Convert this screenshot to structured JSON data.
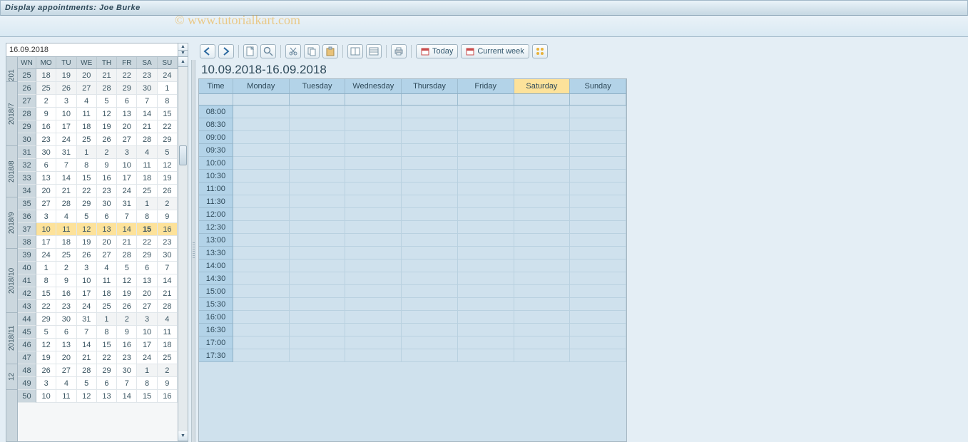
{
  "title": "Display appointments: Joe Burke",
  "watermark": "© www.tutorialkart.com",
  "date_value": "16.09.2018",
  "mini_cal": {
    "dow": [
      "WN",
      "MO",
      "TU",
      "WE",
      "TH",
      "FR",
      "SA",
      "SU"
    ],
    "months": [
      {
        "label": "201",
        "span": 1
      },
      {
        "label": "2018/7",
        "span": 5
      },
      {
        "label": "2018/8",
        "span": 4
      },
      {
        "label": "2018/9",
        "span": 4
      },
      {
        "label": "2018/10",
        "span": 5
      },
      {
        "label": "2018/11",
        "span": 4
      },
      {
        "label": "12",
        "span": 2
      }
    ],
    "weeks": [
      {
        "wn": "25",
        "d": [
          "18",
          "19",
          "20",
          "21",
          "22",
          "23",
          "24"
        ],
        "in": [
          0,
          0,
          0,
          0,
          0,
          0,
          0
        ]
      },
      {
        "wn": "26",
        "d": [
          "25",
          "26",
          "27",
          "28",
          "29",
          "30",
          "1"
        ],
        "in": [
          0,
          0,
          0,
          0,
          0,
          0,
          1
        ]
      },
      {
        "wn": "27",
        "d": [
          "2",
          "3",
          "4",
          "5",
          "6",
          "7",
          "8"
        ],
        "in": [
          1,
          1,
          1,
          1,
          1,
          1,
          1
        ]
      },
      {
        "wn": "28",
        "d": [
          "9",
          "10",
          "11",
          "12",
          "13",
          "14",
          "15"
        ],
        "in": [
          1,
          1,
          1,
          1,
          1,
          1,
          1
        ]
      },
      {
        "wn": "29",
        "d": [
          "16",
          "17",
          "18",
          "19",
          "20",
          "21",
          "22"
        ],
        "in": [
          1,
          1,
          1,
          1,
          1,
          1,
          1
        ]
      },
      {
        "wn": "30",
        "d": [
          "23",
          "24",
          "25",
          "26",
          "27",
          "28",
          "29"
        ],
        "in": [
          1,
          1,
          1,
          1,
          1,
          1,
          1
        ]
      },
      {
        "wn": "31",
        "d": [
          "30",
          "31",
          "1",
          "2",
          "3",
          "4",
          "5"
        ],
        "in": [
          1,
          1,
          0,
          0,
          0,
          0,
          0
        ]
      },
      {
        "wn": "32",
        "d": [
          "6",
          "7",
          "8",
          "9",
          "10",
          "11",
          "12"
        ],
        "in": [
          1,
          1,
          1,
          1,
          1,
          1,
          1
        ]
      },
      {
        "wn": "33",
        "d": [
          "13",
          "14",
          "15",
          "16",
          "17",
          "18",
          "19"
        ],
        "in": [
          1,
          1,
          1,
          1,
          1,
          1,
          1
        ]
      },
      {
        "wn": "34",
        "d": [
          "20",
          "21",
          "22",
          "23",
          "24",
          "25",
          "26"
        ],
        "in": [
          1,
          1,
          1,
          1,
          1,
          1,
          1
        ]
      },
      {
        "wn": "35",
        "d": [
          "27",
          "28",
          "29",
          "30",
          "31",
          "1",
          "2"
        ],
        "in": [
          1,
          1,
          1,
          1,
          1,
          0,
          0
        ]
      },
      {
        "wn": "36",
        "d": [
          "3",
          "4",
          "5",
          "6",
          "7",
          "8",
          "9"
        ],
        "in": [
          1,
          1,
          1,
          1,
          1,
          1,
          1
        ]
      },
      {
        "wn": "37",
        "d": [
          "10",
          "11",
          "12",
          "13",
          "14",
          "15",
          "16"
        ],
        "in": [
          1,
          1,
          1,
          1,
          1,
          1,
          1
        ],
        "sel": true,
        "today_idx": 5
      },
      {
        "wn": "38",
        "d": [
          "17",
          "18",
          "19",
          "20",
          "21",
          "22",
          "23"
        ],
        "in": [
          1,
          1,
          1,
          1,
          1,
          1,
          1
        ]
      },
      {
        "wn": "39",
        "d": [
          "24",
          "25",
          "26",
          "27",
          "28",
          "29",
          "30"
        ],
        "in": [
          1,
          1,
          1,
          1,
          1,
          1,
          1
        ]
      },
      {
        "wn": "40",
        "d": [
          "1",
          "2",
          "3",
          "4",
          "5",
          "6",
          "7"
        ],
        "in": [
          1,
          1,
          1,
          1,
          1,
          1,
          1
        ]
      },
      {
        "wn": "41",
        "d": [
          "8",
          "9",
          "10",
          "11",
          "12",
          "13",
          "14"
        ],
        "in": [
          1,
          1,
          1,
          1,
          1,
          1,
          1
        ]
      },
      {
        "wn": "42",
        "d": [
          "15",
          "16",
          "17",
          "18",
          "19",
          "20",
          "21"
        ],
        "in": [
          1,
          1,
          1,
          1,
          1,
          1,
          1
        ]
      },
      {
        "wn": "43",
        "d": [
          "22",
          "23",
          "24",
          "25",
          "26",
          "27",
          "28"
        ],
        "in": [
          1,
          1,
          1,
          1,
          1,
          1,
          1
        ]
      },
      {
        "wn": "44",
        "d": [
          "29",
          "30",
          "31",
          "1",
          "2",
          "3",
          "4"
        ],
        "in": [
          1,
          1,
          1,
          0,
          0,
          0,
          0
        ]
      },
      {
        "wn": "45",
        "d": [
          "5",
          "6",
          "7",
          "8",
          "9",
          "10",
          "11"
        ],
        "in": [
          1,
          1,
          1,
          1,
          1,
          1,
          1
        ]
      },
      {
        "wn": "46",
        "d": [
          "12",
          "13",
          "14",
          "15",
          "16",
          "17",
          "18"
        ],
        "in": [
          1,
          1,
          1,
          1,
          1,
          1,
          1
        ]
      },
      {
        "wn": "47",
        "d": [
          "19",
          "20",
          "21",
          "22",
          "23",
          "24",
          "25"
        ],
        "in": [
          1,
          1,
          1,
          1,
          1,
          1,
          1
        ]
      },
      {
        "wn": "48",
        "d": [
          "26",
          "27",
          "28",
          "29",
          "30",
          "1",
          "2"
        ],
        "in": [
          1,
          1,
          1,
          1,
          1,
          0,
          0
        ]
      },
      {
        "wn": "49",
        "d": [
          "3",
          "4",
          "5",
          "6",
          "7",
          "8",
          "9"
        ],
        "in": [
          1,
          1,
          1,
          1,
          1,
          1,
          1
        ]
      },
      {
        "wn": "50",
        "d": [
          "10",
          "11",
          "12",
          "13",
          "14",
          "15",
          "16"
        ],
        "in": [
          1,
          1,
          1,
          1,
          1,
          1,
          1
        ]
      }
    ]
  },
  "toolbar": {
    "today": "Today",
    "current_week": "Current week"
  },
  "week_view": {
    "range": "10.09.2018-16.09.2018",
    "days": [
      "Time",
      "Monday",
      "Tuesday",
      "Wednesday",
      "Thursday",
      "Friday",
      "Saturday",
      "Sunday"
    ],
    "highlight_day_index": 6,
    "times": [
      "08:00",
      "08:30",
      "09:00",
      "09:30",
      "10:00",
      "10:30",
      "11:00",
      "11:30",
      "12:00",
      "12:30",
      "13:00",
      "13:30",
      "14:00",
      "14:30",
      "15:00",
      "15:30",
      "16:00",
      "16:30",
      "17:00",
      "17:30"
    ]
  },
  "icons": {
    "back": "back-arrow",
    "fwd": "forward-arrow",
    "new": "new-document",
    "magnify": "magnifier",
    "cut": "scissors",
    "copy": "copy",
    "paste": "paste",
    "layout1": "column-view",
    "layout2": "list-view",
    "print": "printer",
    "cal1": "calendar",
    "cal2": "calendar",
    "grid": "grid-4"
  }
}
